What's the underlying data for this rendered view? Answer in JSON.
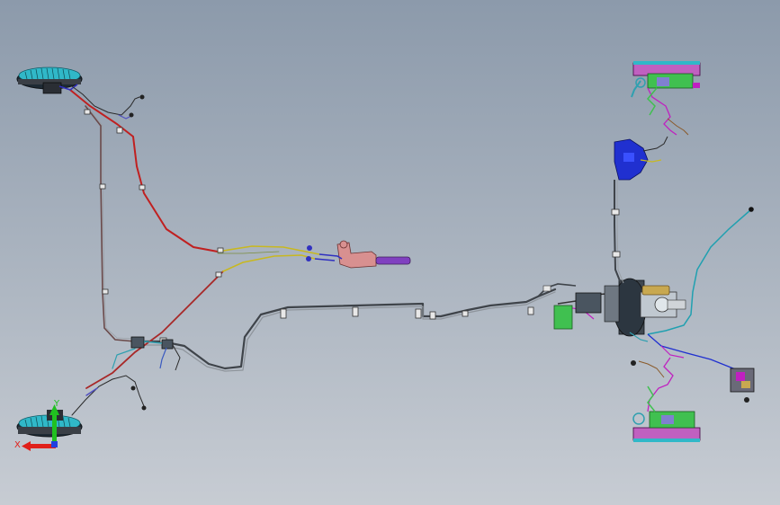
{
  "viewport": {
    "background_top": "#8c9aab",
    "background_bottom": "#c7ccd3"
  },
  "triad": {
    "x_label": "X",
    "y_label": "Y",
    "x_color": "#e0201a",
    "y_color": "#20c020",
    "z_color": "#2040e0"
  },
  "colors": {
    "steel_line": "#5a5f66",
    "parking_cable": "#c02020",
    "cable_yellow": "#c8b820",
    "hose_cyan": "#20a0b0",
    "booster_blue": "#2030d0",
    "magenta_wire": "#c020c0",
    "green_part": "#30c040",
    "lever_pink": "#d89090",
    "lever_grip": "#8040c0",
    "brake_disc": "#30b8c8"
  }
}
